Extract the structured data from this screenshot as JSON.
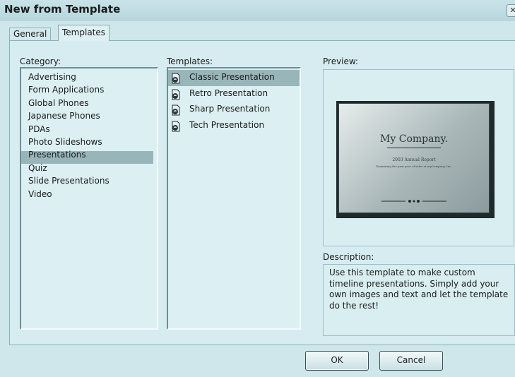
{
  "window": {
    "title": "New from Template",
    "close_glyph": "✕"
  },
  "tabs": [
    {
      "label": "General"
    },
    {
      "label": "Templates"
    }
  ],
  "category": {
    "label": "Category:",
    "items": [
      "Advertising",
      "Form Applications",
      "Global Phones",
      "Japanese Phones",
      "PDAs",
      "Photo Slideshows",
      "Presentations",
      "Quiz",
      "Slide Presentations",
      "Video"
    ],
    "selected": "Presentations"
  },
  "templates": {
    "label": "Templates:",
    "items": [
      "Classic Presentation",
      "Retro Presentation",
      "Sharp Presentation",
      "Tech Presentation"
    ],
    "selected": "Classic Presentation",
    "icon": "template-document-icon"
  },
  "preview": {
    "label": "Preview:",
    "slide": {
      "company": "My Company.",
      "subtitle": "2003 Annual Report",
      "tagline": "Examining the past year of sales at myCompany, Inc."
    }
  },
  "description": {
    "label": "Description:",
    "text": "Use this template to make custom timeline presentations. Simply add your own images and text and let the template do the rest!"
  },
  "buttons": {
    "ok": "OK",
    "cancel": "Cancel"
  },
  "colors": {
    "background": "#cfe6ea",
    "selection": "#98b6ba"
  }
}
